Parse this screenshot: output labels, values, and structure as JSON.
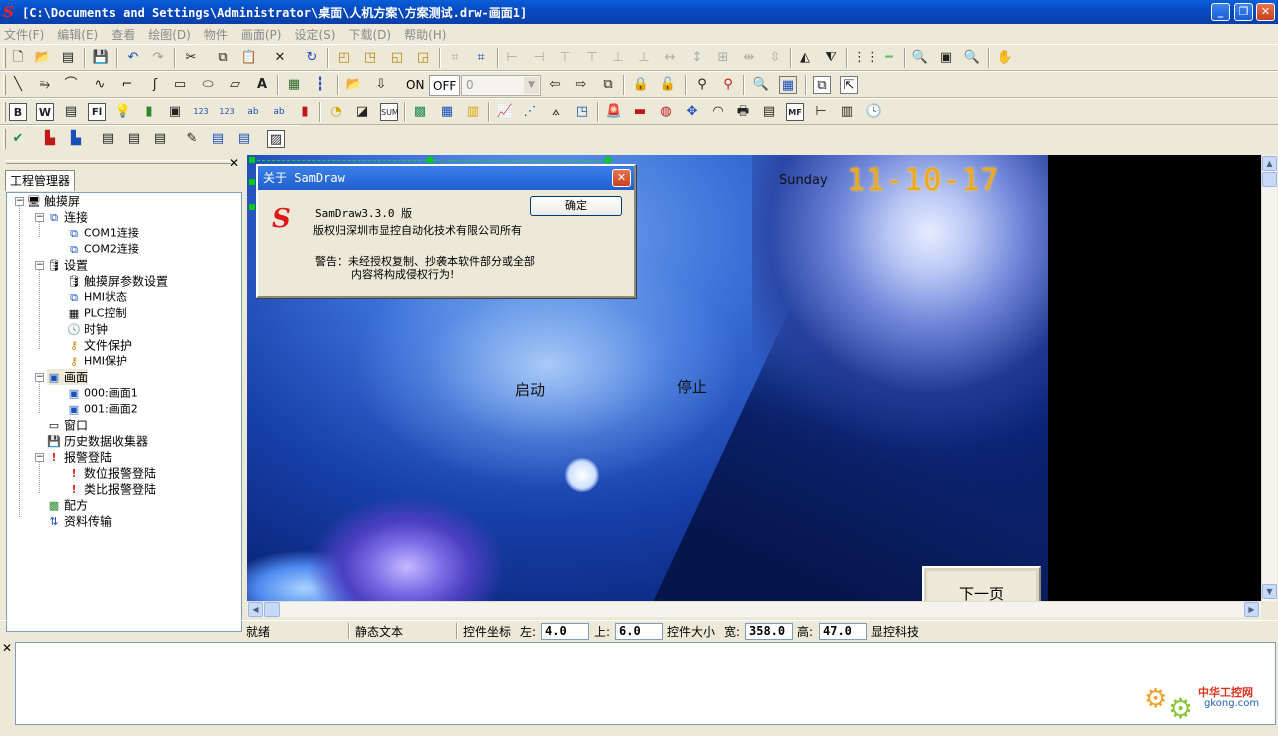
{
  "window": {
    "title": "[C:\\Documents and Settings\\Administrator\\桌面\\人机方案\\方案测试.drw-画面1]",
    "logo": "S",
    "minimize": "_",
    "restore": "❐",
    "close": "✕"
  },
  "menu": [
    "文件(F)",
    "编辑(E)",
    "查看",
    "绘图(D)",
    "物件",
    "画面(P)",
    "设定(S)",
    "下载(D)",
    "帮助(H)"
  ],
  "toolbar2": {
    "on_label": "ON",
    "off_label": "OFF",
    "combo_value": "0",
    "combo_arrow": "▼"
  },
  "project_manager": {
    "tab": "工程管理器",
    "close": "✕",
    "tree": [
      {
        "label": "触摸屏",
        "icon": "monitor-icon"
      },
      {
        "label": "连接",
        "icon": "network-icon"
      },
      {
        "label": "COM1连接",
        "icon": "connection-icon"
      },
      {
        "label": "COM2连接",
        "icon": "connection-icon"
      },
      {
        "label": "设置",
        "icon": "database-icon"
      },
      {
        "label": "触摸屏参数设置",
        "icon": "database-icon"
      },
      {
        "label": "HMI状态",
        "icon": "hmi-status-icon"
      },
      {
        "label": "PLC控制",
        "icon": "plc-icon"
      },
      {
        "label": "时钟",
        "icon": "clock-icon"
      },
      {
        "label": "文件保护",
        "icon": "key-icon"
      },
      {
        "label": "HMI保护",
        "icon": "key-icon"
      },
      {
        "label": "画面",
        "icon": "screen-icon"
      },
      {
        "label": "000:画面1",
        "icon": "screen-icon"
      },
      {
        "label": "001:画面2",
        "icon": "screen-icon"
      },
      {
        "label": "窗口",
        "icon": "window-icon"
      },
      {
        "label": "历史数据收集器",
        "icon": "disk-icon"
      },
      {
        "label": "报警登陆",
        "icon": "alarm-icon"
      },
      {
        "label": "数位报警登陆",
        "icon": "alarm-icon"
      },
      {
        "label": "类比报警登陆",
        "icon": "alarm-icon"
      },
      {
        "label": "配方",
        "icon": "recipe-icon"
      },
      {
        "label": "资料传输",
        "icon": "transfer-icon"
      }
    ]
  },
  "screen": {
    "day": "Sunday",
    "date": "11-10-17",
    "start_label": "启动",
    "stop_label": "停止",
    "next_page": "下一页"
  },
  "dialog": {
    "title": "关于 SamDraw",
    "logo": "S",
    "ok": "确定",
    "version": "SamDraw3.3.0 版",
    "copyright": "版权归深圳市显控自动化技术有限公司所有",
    "warning1": "警告：未经授权复制、抄袭本软件部分或全部",
    "warning2": "内容将构成侵权行为!"
  },
  "status": {
    "state": "就绪",
    "object": "静态文本",
    "coord_label": "控件坐标",
    "left_label": "左:",
    "left_value": "4.0",
    "top_label": "上:",
    "top_value": "6.0",
    "size_label": "控件大小",
    "width_label": "宽:",
    "width_value": "358.0",
    "height_label": "高:",
    "height_value": "47.0",
    "company": "显控科技"
  },
  "output": {
    "close": "✕"
  },
  "watermark": {
    "cn": "中华工控网",
    "en": "gkong.com"
  }
}
